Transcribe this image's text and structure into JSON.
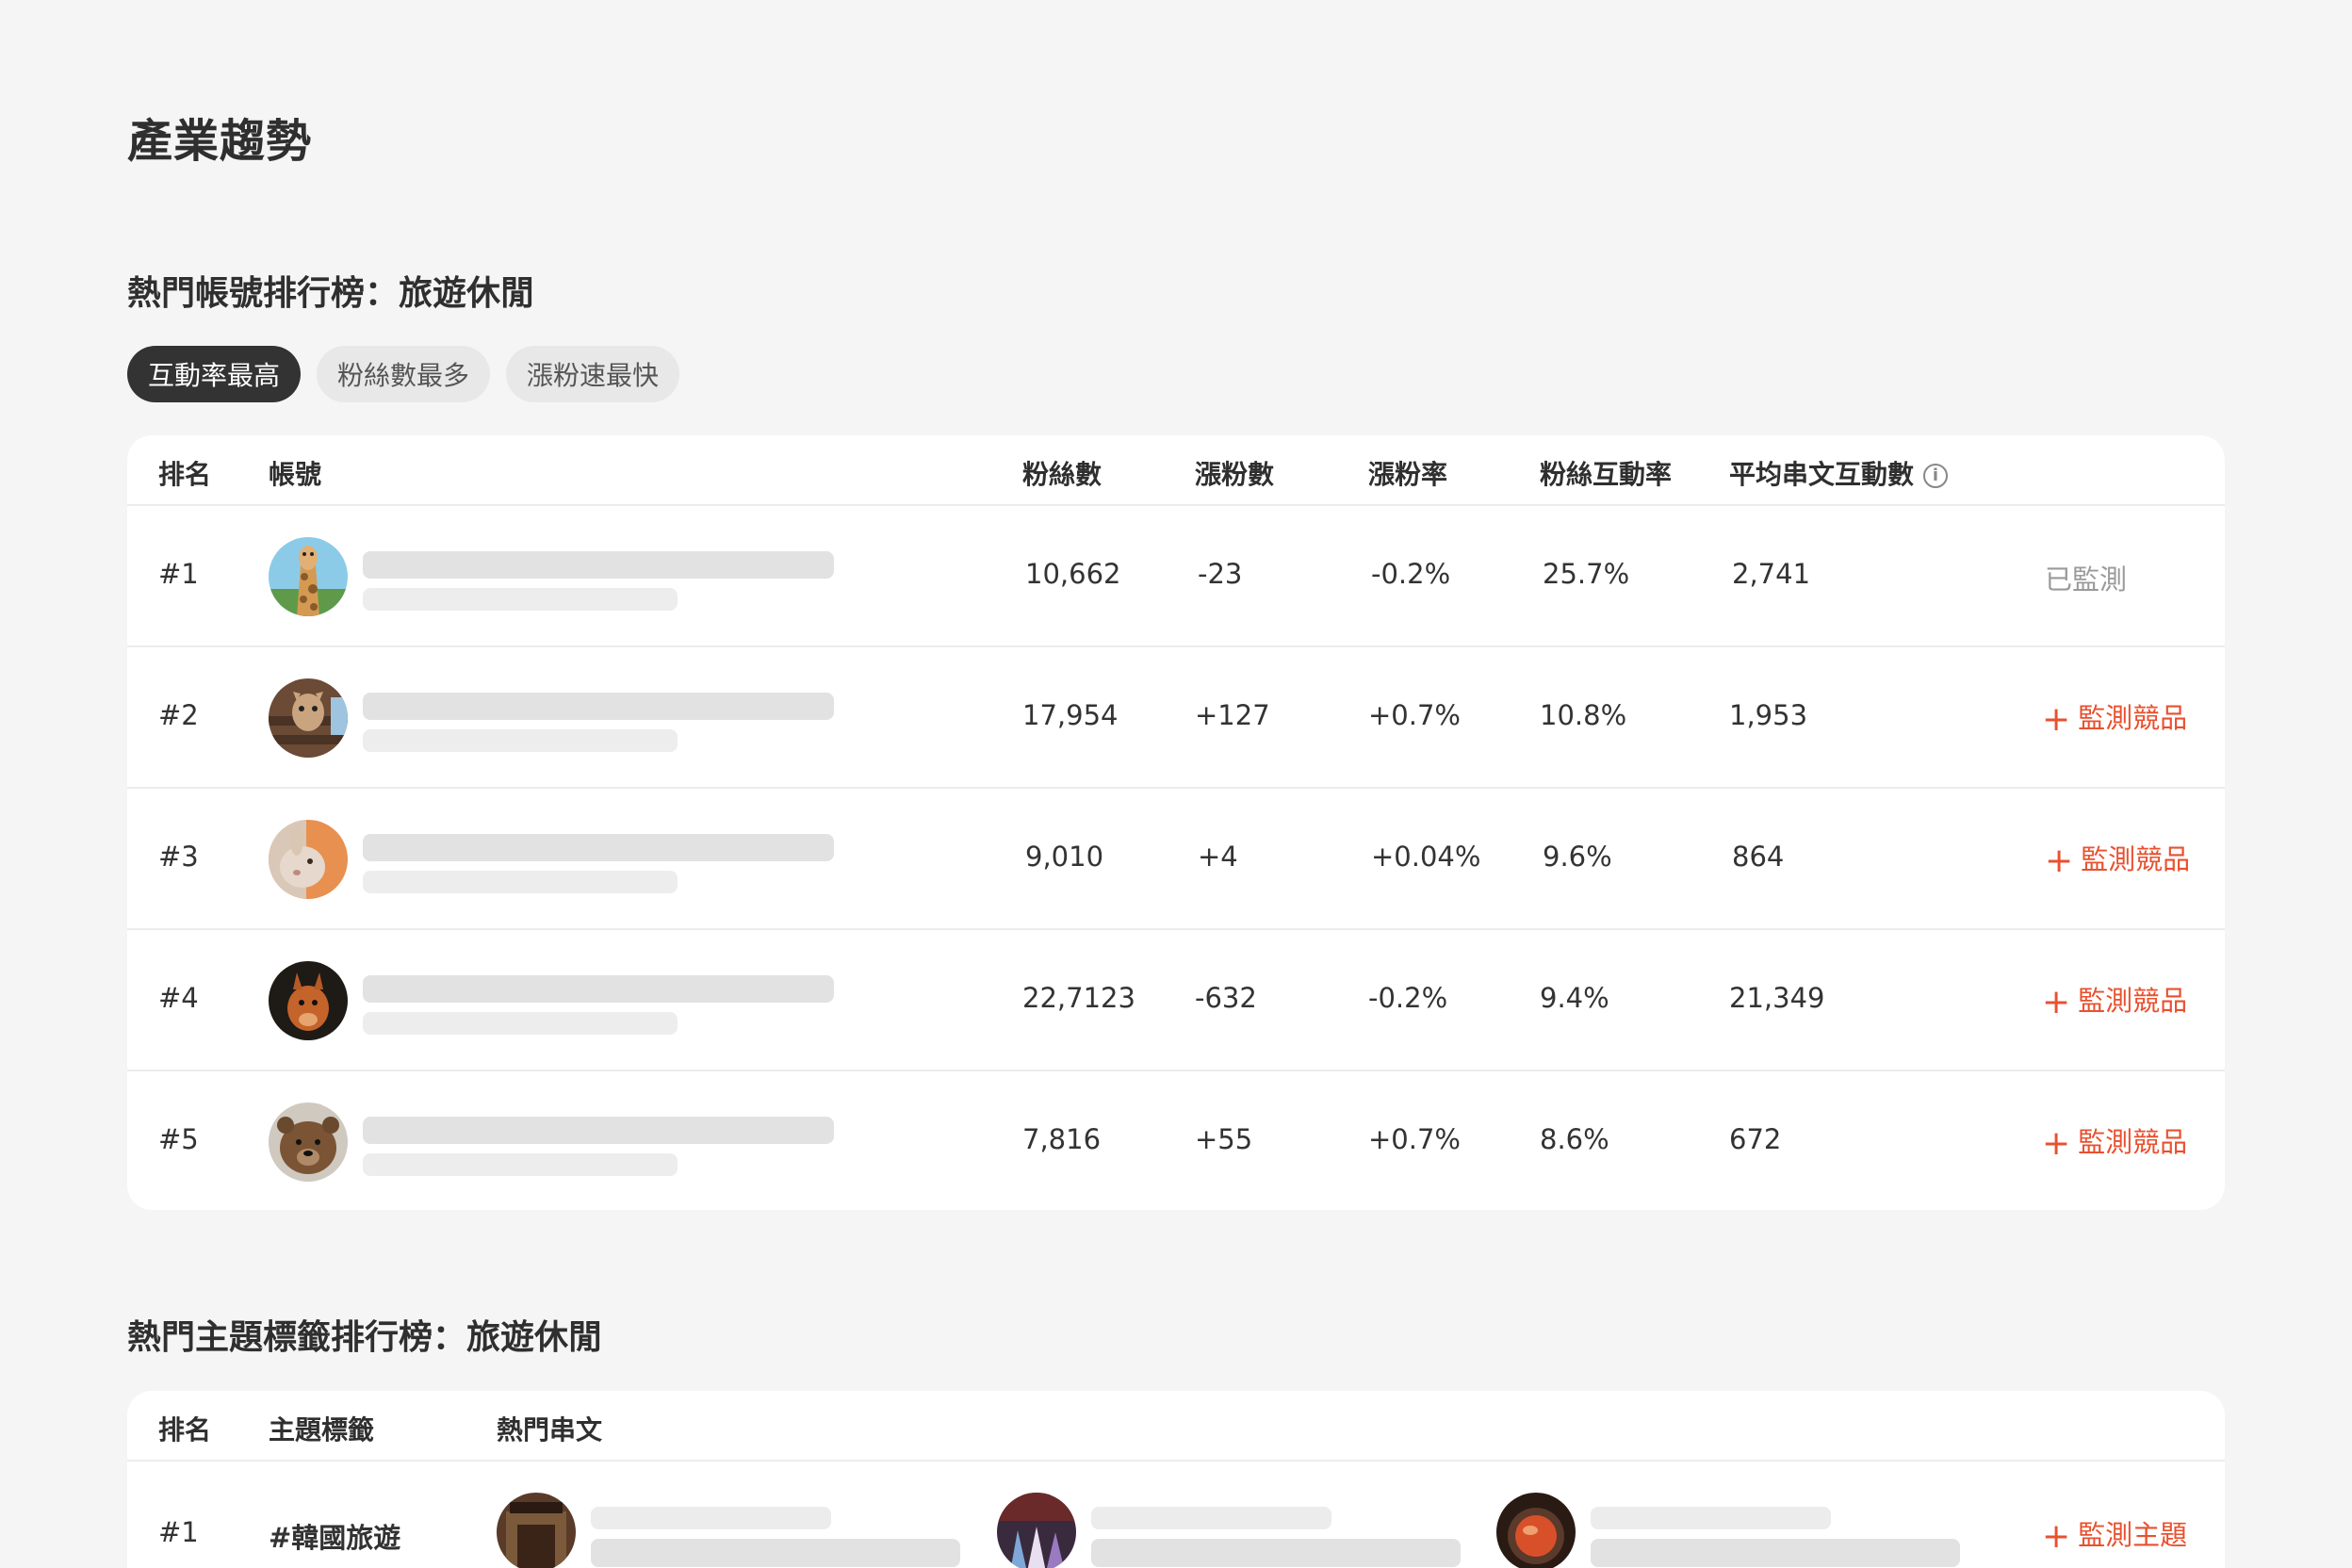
{
  "page": {
    "title": "產業趨勢"
  },
  "accounts_section": {
    "title": "熱門帳號排行榜：旅遊休閒",
    "tabs": [
      {
        "label": "互動率最高",
        "active": true
      },
      {
        "label": "粉絲數最多",
        "active": false
      },
      {
        "label": "漲粉速最快",
        "active": false
      }
    ],
    "columns": {
      "rank": "排名",
      "account": "帳號",
      "followers": "粉絲數",
      "follower_growth": "漲粉數",
      "growth_rate": "漲粉率",
      "engagement_rate": "粉絲互動率",
      "avg_post_engagement": "平均串文互動數"
    },
    "rows": [
      {
        "rank": "#1",
        "avatar": "giraffe-avatar",
        "followers": "10,662",
        "growth": "-23",
        "growth_rate": "-0.2%",
        "engagement": "25.7%",
        "avg": "2,741",
        "action": "已監測",
        "monitored": true
      },
      {
        "rank": "#2",
        "avatar": "llama-avatar",
        "followers": "17,954",
        "growth": "+127",
        "growth_rate": "+0.7%",
        "engagement": "10.8%",
        "avg": "1,953",
        "action": "監測競品",
        "monitored": false
      },
      {
        "rank": "#3",
        "avatar": "rabbit-avatar",
        "followers": "9,010",
        "growth": "+4",
        "growth_rate": "+0.04%",
        "engagement": "9.6%",
        "avg": "864",
        "action": "監測競品",
        "monitored": false
      },
      {
        "rank": "#4",
        "avatar": "squirrel-avatar",
        "followers": "22,7123",
        "growth": "-632",
        "growth_rate": "-0.2%",
        "engagement": "9.4%",
        "avg": "21,349",
        "action": "監測競品",
        "monitored": false
      },
      {
        "rank": "#5",
        "avatar": "bear-avatar",
        "followers": "7,816",
        "growth": "+55",
        "growth_rate": "+0.7%",
        "engagement": "8.6%",
        "avg": "672",
        "action": "監測競品",
        "monitored": false
      }
    ]
  },
  "hashtags_section": {
    "title": "熱門主題標籤排行榜：旅遊休閒",
    "columns": {
      "rank": "排名",
      "tag": "主題標籤",
      "posts": "熱門串文"
    },
    "rows": [
      {
        "rank": "#1",
        "tag": "#韓國旅遊",
        "action": "監測主題"
      }
    ]
  },
  "colors": {
    "accent": "#e8512f",
    "active_chip": "#333333",
    "background": "#f5f5f5"
  }
}
